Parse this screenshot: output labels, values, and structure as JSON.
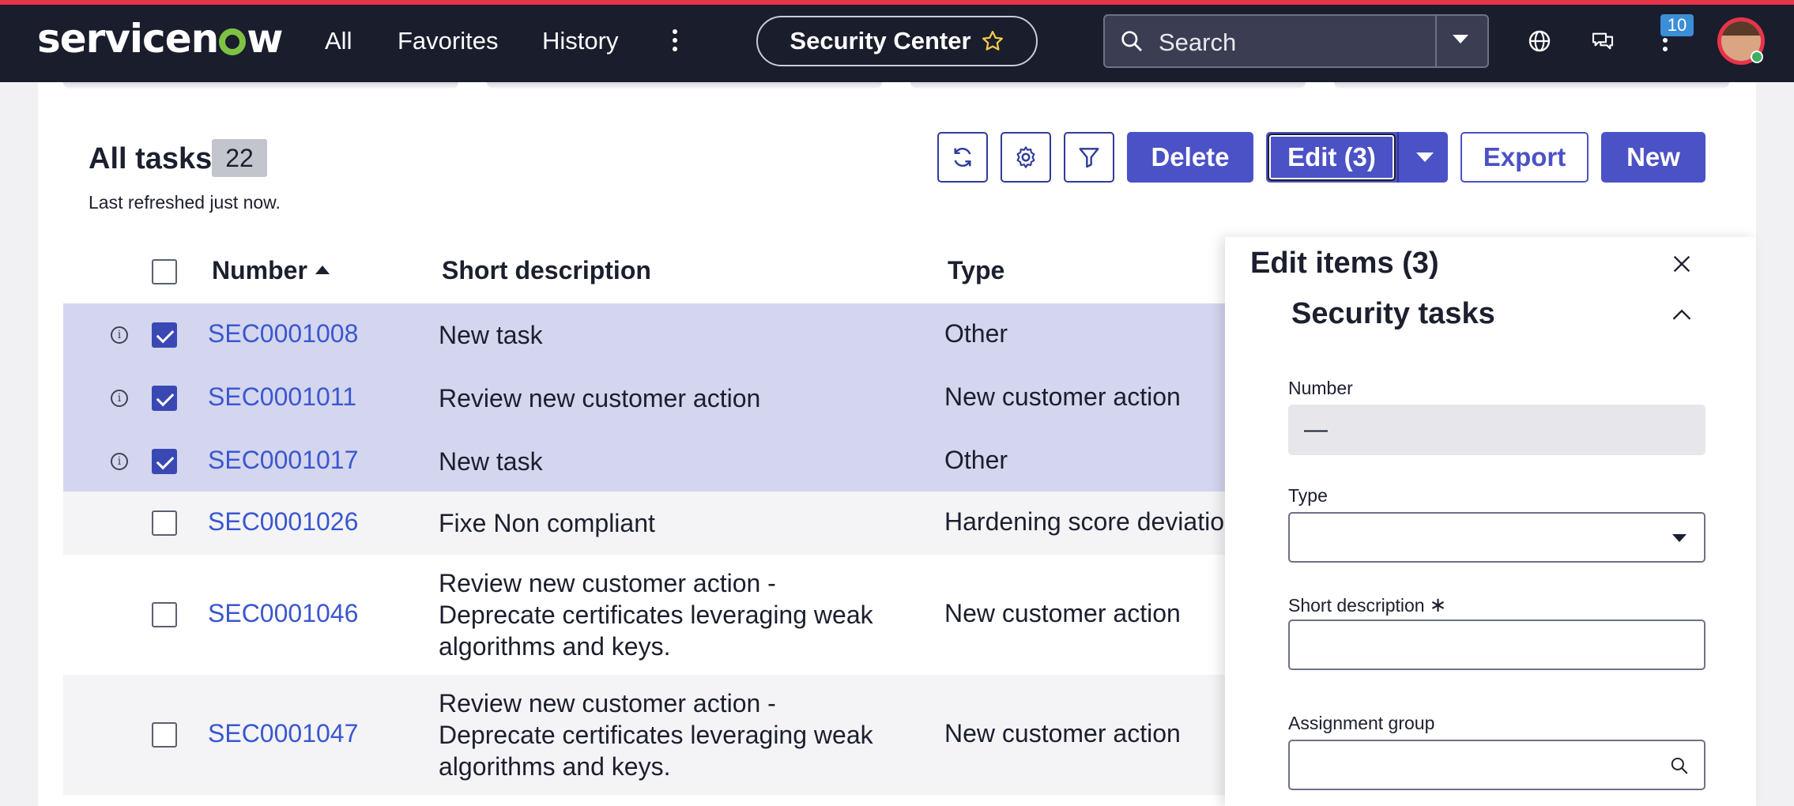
{
  "nav": {
    "logo": "servicenow",
    "links": [
      "All",
      "Favorites",
      "History"
    ],
    "app_pill": "Security Center",
    "search_placeholder": "Search",
    "notification_count": "10"
  },
  "colors": {
    "brand_red": "#e8344b",
    "primary": "#4b52c6",
    "link": "#3b57d0",
    "selected_row": "#d4d6ef",
    "topbar": "#1a1d2c"
  },
  "list": {
    "title": "All tasks",
    "count": "22",
    "refreshed": "Last refreshed just now.",
    "buttons": {
      "delete": "Delete",
      "edit": "Edit (3)",
      "export": "Export",
      "new": "New"
    },
    "icons": [
      "refresh-icon",
      "settings-icon",
      "filter-icon"
    ],
    "columns": {
      "number": "Number",
      "short_description": "Short description",
      "type": "Type"
    },
    "sort": {
      "column": "Number",
      "direction": "ascending"
    },
    "rows": [
      {
        "number": "SEC0001008",
        "desc": "New task",
        "type": "Other",
        "selected": true
      },
      {
        "number": "SEC0001011",
        "desc": "Review new customer action",
        "type": "New customer action",
        "selected": true
      },
      {
        "number": "SEC0001017",
        "desc": "New task",
        "type": "Other",
        "selected": true
      },
      {
        "number": "SEC0001026",
        "desc": "Fixe Non compliant",
        "type": "Hardening score deviation",
        "selected": false
      },
      {
        "number": "SEC0001046",
        "desc": "Review new customer action - Deprecate certificates leveraging weak algorithms and keys.",
        "type": "New customer action",
        "selected": false
      },
      {
        "number": "SEC0001047",
        "desc": "Review new customer action - Deprecate certificates leveraging weak algorithms and keys.",
        "type": "New customer action",
        "selected": false
      }
    ]
  },
  "panel": {
    "title": "Edit items (3)",
    "section": "Security tasks",
    "fields": {
      "number_label": "Number",
      "number_value": "—",
      "type_label": "Type",
      "short_description_label": "Short description",
      "required_mark": "∗",
      "assignment_group_label": "Assignment group"
    }
  }
}
